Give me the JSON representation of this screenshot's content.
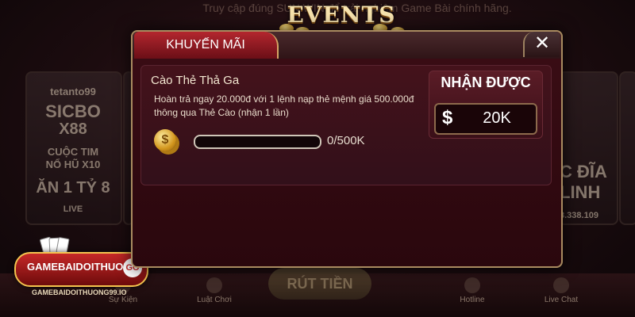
{
  "background": {
    "top_text": "Truy cập đúng  SUN.WIN  để trải nghiệm Game Bài chính hãng.",
    "left_card": {
      "brand": "tetanto99",
      "lines": [
        "SICBO",
        "X88",
        "CUỘC TIM",
        "NỔ HŨ X10",
        "ĂN 1 TỶ 8",
        "LIVE"
      ]
    },
    "right_card": {
      "lines": [
        "C ĐĨA",
        "LINH",
        "8.338.109"
      ]
    },
    "bottom_nav": [
      {
        "label": "Sự Kiện",
        "icon": "trophy-icon"
      },
      {
        "label": "Luật Chơi",
        "icon": "rules-icon"
      },
      {
        "label": "Hotline",
        "icon": "phone-icon"
      },
      {
        "label": "Live Chat",
        "icon": "chat-icon"
      }
    ],
    "rut_tien_label": "RÚT TIỀN"
  },
  "logo": {
    "name": "GAMEBAIDOITHUONG",
    "badge": "GO",
    "sub": "GAMEBAIDOITHUONG99.IO"
  },
  "events_title": "EVENTS",
  "modal": {
    "tab_label": "KHUYẾN MÃI",
    "close_icon": "close-icon",
    "promo": {
      "title": "Cào Thẻ Thả Ga",
      "description": "Hoàn trả ngay 20.000đ với 1 lệnh nạp thẻ mệnh giá 500.000đ thông qua Thẻ Cào (nhận 1 lần)",
      "coin_icon": "coin-icon",
      "progress_value": 0,
      "progress_text": "0/500K"
    },
    "reward": {
      "label": "NHẬN ĐƯỢC",
      "currency_icon": "dollar-icon",
      "currency_symbol": "$",
      "value": "20K"
    }
  },
  "colors": {
    "tab_active": "#b3262e",
    "modal_bg": "#3b0d15",
    "gold": "#d5a564"
  }
}
